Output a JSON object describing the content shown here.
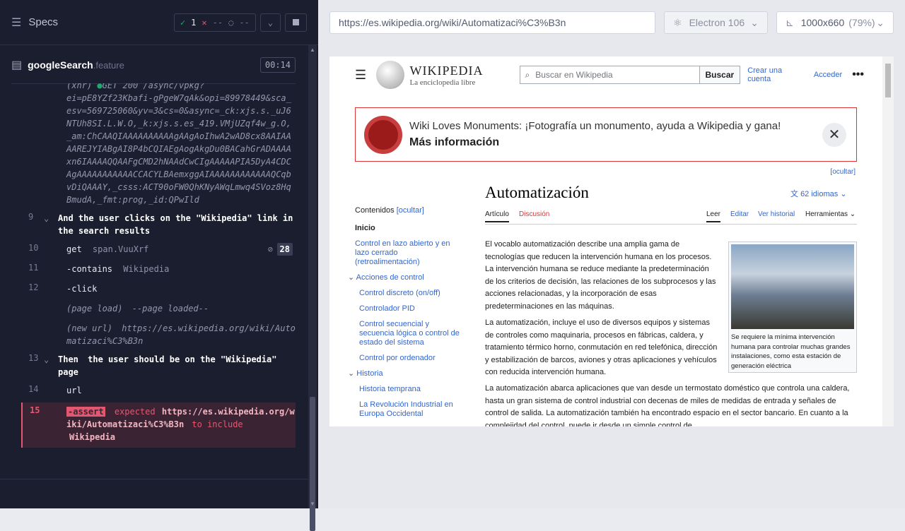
{
  "runner": {
    "specs_label": "Specs",
    "passed": "1",
    "failed": "--",
    "pending": "--",
    "file_name": "googleSearch",
    "file_ext": ".feature",
    "timer": "00:14",
    "log": {
      "xhr_prefix": "(xhr)",
      "xhr_line": "GET 200 /async/vpkg?",
      "xhr_rest": "ei=pE8YZf23Kbafi-gPgeW7qAk&opi=89978449&sca_esv=569725060&yv=3&cs=0&async=_ck:xjs.s._uJ6NTUh8SI.L.W.O,_k:xjs.s.es_419.VMjUZqf4w_g.O,_am:ChCAAQIAAAAAAAAAAgAAgAoIhwA2wAD8cx8AAIAAAAREJYIABgAI8P4bCQIAEgAogAkgDu0BACahGrADAAAAxn6IAAAAQQAAFgCMD2hNAAdCwCIgAAAAAPIA5DyA4CDCAgAAAAAAAAAAACCACYLBAemxggAIAAAAAAAAAAAAQCqbvDiQAAAY,_csss:ACT90oFW0QhKNyAWqLmwq4SVoz8HqBmudA,_fmt:prog,_id:QPwIld",
      "step9_num": "9",
      "step9_kw": "And",
      "step9_text": "the user clicks on the \"Wikipedia\" link in the search results",
      "l10_num": "10",
      "l10_cmd": "get",
      "l10_arg": "span.VuuXrf",
      "l10_count": "28",
      "l11_num": "11",
      "l11_cmd": "-contains",
      "l11_arg": "Wikipedia",
      "l12_num": "12",
      "l12_cmd": "-click",
      "page_load": "(page load)",
      "page_loaded": "--page loaded--",
      "new_url": "(new url)",
      "new_url_val": "https://es.wikipedia.org/wiki/Automatizaci%C3%B3n",
      "step13_num": "13",
      "step13_kw": "Then",
      "step13_text": "the user should be on the \"Wikipedia\" page",
      "l14_num": "14",
      "l14_cmd": "url",
      "l15_num": "15",
      "l15_cmd": "-assert",
      "l15_expected": "expected",
      "l15_url": "https://es.wikipedia.org/wiki/Automatizaci%C3%B3n",
      "l15_to_include": "to include",
      "l15_val": "Wikipedia"
    }
  },
  "browser": {
    "url": "https://es.wikipedia.org/wiki/Automatizaci%C3%B3n",
    "browser_name": "Electron 106",
    "viewport": "1000x660",
    "zoom": "(79%)"
  },
  "wiki": {
    "logo_title": "WIKIPEDIA",
    "logo_sub": "La enciclopedia libre",
    "search_placeholder": "Buscar en Wikipedia",
    "search_btn": "Buscar",
    "create_account": "Crear una cuenta",
    "login": "Acceder",
    "banner_text": "Wiki Loves Monuments: ¡Fotografía un monumento, ayuda a Wikipedia y gana!",
    "banner_more": "Más información",
    "hide": "[ocultar]",
    "title": "Automatización",
    "languages": "62 idiomas",
    "tab_article": "Artículo",
    "tab_discussion": "Discusión",
    "tab_read": "Leer",
    "tab_edit": "Editar",
    "tab_history": "Ver historial",
    "tab_tools": "Herramientas",
    "toc_label": "Contenidos",
    "toc_hide": "[ocultar]",
    "toc_items": [
      "Inicio",
      "Control en lazo abierto y en lazo cerrado (retroalimentación)",
      "Acciones de control",
      "Control discreto (on/off)",
      "Controlador PID",
      "Control secuencial y secuencia lógica o control de estado del sistema",
      "Control por ordenador",
      "Historia",
      "Historia temprana",
      "La Revolución Industrial en Europa Occidental"
    ],
    "p1": "El vocablo automatización describe una amplia gama de tecnologías que reducen la intervención humana en los procesos. La intervención humana se reduce mediante la predeterminación de los criterios de decisión, las relaciones de los subprocesos y las acciones relacionadas, y la incorporación de esas predeterminaciones en las máquinas.",
    "p2": "La automatización, incluye el uso de diversos equipos y sistemas de controles como maquinaria, procesos en fábricas, caldera, y tratamiento térmico horno, conmutación en red telefónica, dirección y estabilización de barcos, aviones y otras aplicaciones y vehículos con reducida intervención humana.",
    "p3": "La automatización abarca aplicaciones que van desde un termostato doméstico que controla una caldera, hasta un gran sistema de control industrial con decenas de miles de medidas de entrada y señales de control de salida. La automatización también ha encontrado espacio en el sector bancario. En cuanto a la complejidad del control, puede ir desde un simple control de",
    "caption": "Se requiere la mínima intervención humana para controlar muchas grandes instalaciones, como esta estación de generación eléctrica"
  }
}
